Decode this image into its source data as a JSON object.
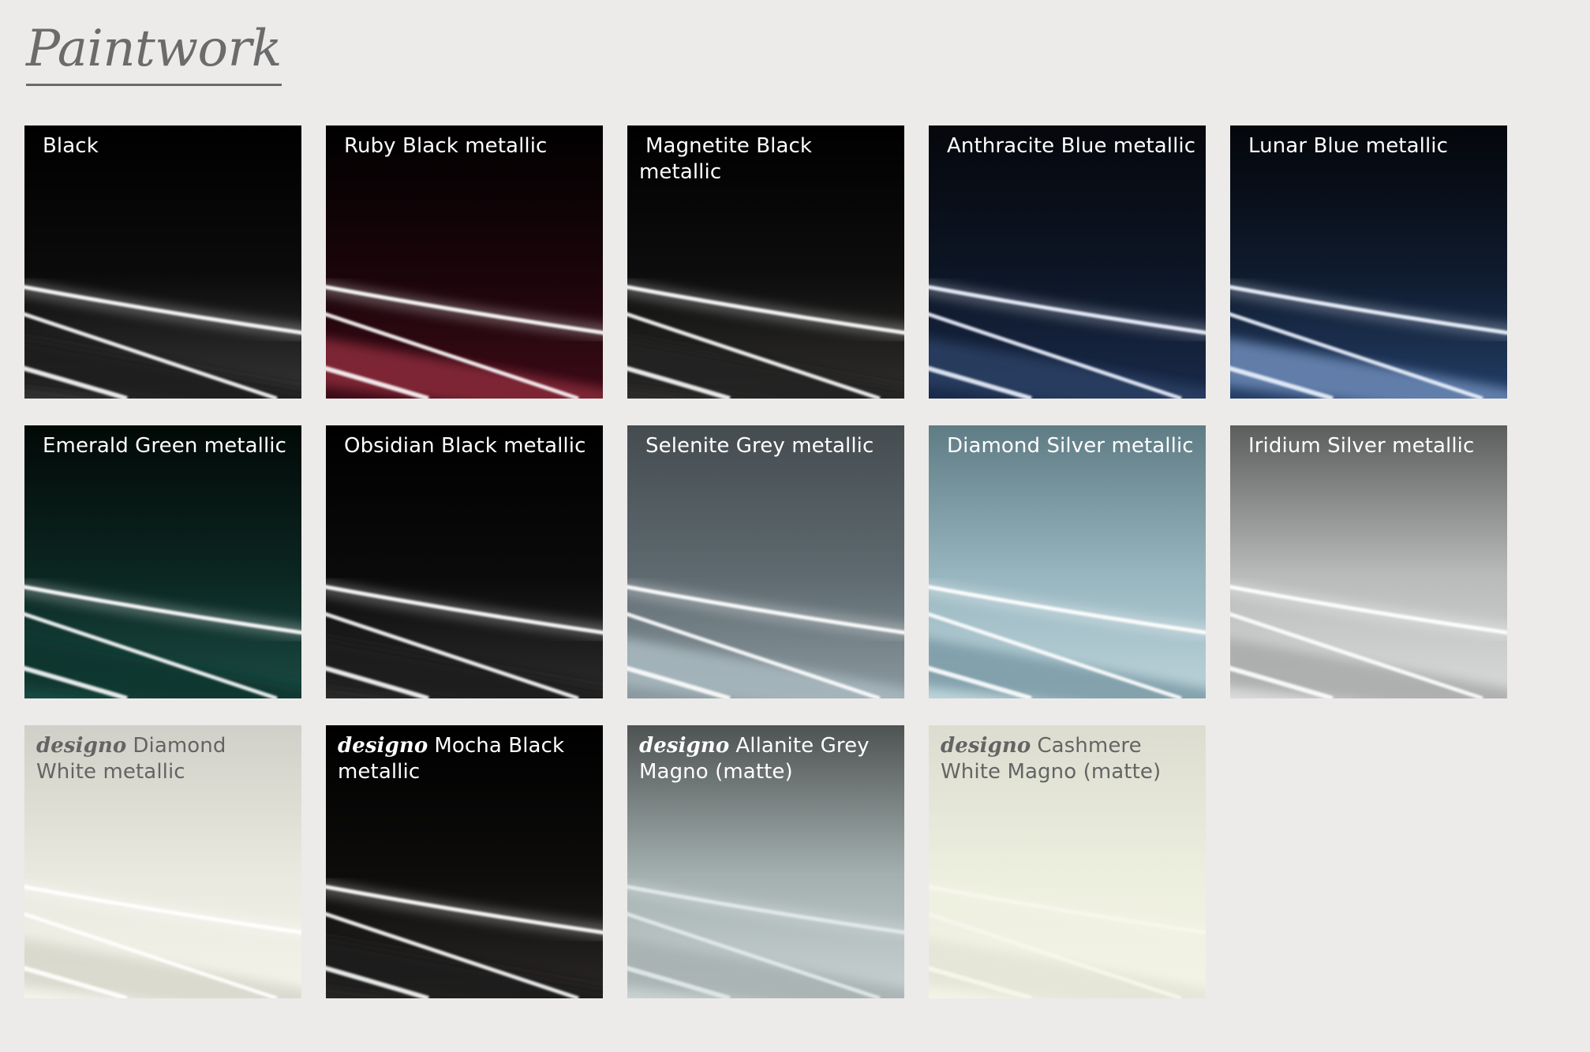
{
  "page": {
    "title": "Paintwork",
    "background": "#ecebe9"
  },
  "swatches": [
    {
      "id": "black",
      "series": "",
      "label": "Black",
      "top": "#000000",
      "mid": "#0b0b0b",
      "bottom": "#353535",
      "band": "#1f1f1f",
      "streak": "#ffffff"
    },
    {
      "id": "ruby-black",
      "series": "",
      "label": "Ruby Black metallic",
      "top": "#000000",
      "mid": "#1a050a",
      "bottom": "#3c0b17",
      "band": "#8a2a3a",
      "streak": "#ffffff"
    },
    {
      "id": "magnetite-black",
      "series": "",
      "label": "Magnetite Black metallic",
      "top": "#000000",
      "mid": "#0d0d0d",
      "bottom": "#2f2e2c",
      "band": "#222120",
      "streak": "#ffffff"
    },
    {
      "id": "anthracite-blue",
      "series": "",
      "label": "Anthracite Blue metallic",
      "top": "#05070c",
      "mid": "#0d1626",
      "bottom": "#1a2a4a",
      "band": "#2c3f63",
      "streak": "#eef3ff"
    },
    {
      "id": "lunar-blue",
      "series": "",
      "label": "Lunar Blue metallic",
      "top": "#04060a",
      "mid": "#0f1b2e",
      "bottom": "#233e66",
      "band": "#6d8ab7",
      "streak": "#eef4ff"
    },
    {
      "id": "emerald-green",
      "series": "",
      "label": "Emerald Green metallic",
      "top": "#020907",
      "mid": "#0b2621",
      "bottom": "#1a4b43",
      "band": "#10352f",
      "streak": "#ffffff"
    },
    {
      "id": "obsidian-black",
      "series": "",
      "label": "Obsidian Black metallic",
      "top": "#000000",
      "mid": "#0a0a0a",
      "bottom": "#2c2c2c",
      "band": "#1c1c1c",
      "streak": "#ffffff"
    },
    {
      "id": "selenite-grey",
      "series": "",
      "label": "Selenite Grey metallic",
      "top": "#454c50",
      "mid": "#5e6a70",
      "bottom": "#8b9aa0",
      "band": "#a9b9c0",
      "streak": "#ffffff"
    },
    {
      "id": "diamond-silver",
      "series": "",
      "label": "Diamond Silver metallic",
      "top": "#5f7c85",
      "mid": "#98b6bf",
      "bottom": "#bcd3da",
      "band": "#7a9aa5",
      "streak": "#ffffff"
    },
    {
      "id": "iridium-silver",
      "series": "",
      "label": "Iridium Silver metallic",
      "top": "#5c5d5d",
      "mid": "#b9baba",
      "bottom": "#d9dada",
      "band": "#a8a9a9",
      "streak": "#ffffff"
    },
    {
      "id": "designo-diamond-white",
      "series": "designo",
      "label": "Diamond White metallic",
      "top": "#d0d0c8",
      "mid": "#e9e9df",
      "bottom": "#f3f3ea",
      "band": "#d6d6ca",
      "streak": "#ffffff"
    },
    {
      "id": "designo-mocha-black",
      "series": "designo",
      "label": "Mocha Black metallic",
      "top": "#000000",
      "mid": "#0d0c0b",
      "bottom": "#2a2725",
      "band": "#1e1c1a",
      "streak": "#ffffff"
    },
    {
      "id": "designo-allanite-grey",
      "series": "designo",
      "label": "Allanite Grey Magno (matte)",
      "top": "#4e5352",
      "mid": "#a4b0b0",
      "bottom": "#c9d2d2",
      "band": "#a6b0b0",
      "streak": "#e3eaea"
    },
    {
      "id": "designo-cashmere-white",
      "series": "designo",
      "label": "Cashmere White Magno (matte)",
      "top": "#dcddd0",
      "mid": "#eceede",
      "bottom": "#f4f4e6",
      "band": "#e3e4d5",
      "streak": "#f7f7ec"
    }
  ]
}
